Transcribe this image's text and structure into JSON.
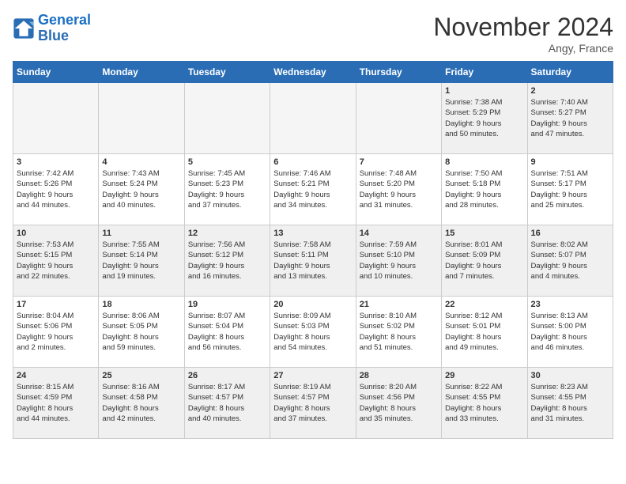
{
  "header": {
    "logo_line1": "General",
    "logo_line2": "Blue",
    "month": "November 2024",
    "location": "Angy, France"
  },
  "weekdays": [
    "Sunday",
    "Monday",
    "Tuesday",
    "Wednesday",
    "Thursday",
    "Friday",
    "Saturday"
  ],
  "weeks": [
    [
      {
        "day": "",
        "info": ""
      },
      {
        "day": "",
        "info": ""
      },
      {
        "day": "",
        "info": ""
      },
      {
        "day": "",
        "info": ""
      },
      {
        "day": "",
        "info": ""
      },
      {
        "day": "1",
        "info": "Sunrise: 7:38 AM\nSunset: 5:29 PM\nDaylight: 9 hours\nand 50 minutes."
      },
      {
        "day": "2",
        "info": "Sunrise: 7:40 AM\nSunset: 5:27 PM\nDaylight: 9 hours\nand 47 minutes."
      }
    ],
    [
      {
        "day": "3",
        "info": "Sunrise: 7:42 AM\nSunset: 5:26 PM\nDaylight: 9 hours\nand 44 minutes."
      },
      {
        "day": "4",
        "info": "Sunrise: 7:43 AM\nSunset: 5:24 PM\nDaylight: 9 hours\nand 40 minutes."
      },
      {
        "day": "5",
        "info": "Sunrise: 7:45 AM\nSunset: 5:23 PM\nDaylight: 9 hours\nand 37 minutes."
      },
      {
        "day": "6",
        "info": "Sunrise: 7:46 AM\nSunset: 5:21 PM\nDaylight: 9 hours\nand 34 minutes."
      },
      {
        "day": "7",
        "info": "Sunrise: 7:48 AM\nSunset: 5:20 PM\nDaylight: 9 hours\nand 31 minutes."
      },
      {
        "day": "8",
        "info": "Sunrise: 7:50 AM\nSunset: 5:18 PM\nDaylight: 9 hours\nand 28 minutes."
      },
      {
        "day": "9",
        "info": "Sunrise: 7:51 AM\nSunset: 5:17 PM\nDaylight: 9 hours\nand 25 minutes."
      }
    ],
    [
      {
        "day": "10",
        "info": "Sunrise: 7:53 AM\nSunset: 5:15 PM\nDaylight: 9 hours\nand 22 minutes."
      },
      {
        "day": "11",
        "info": "Sunrise: 7:55 AM\nSunset: 5:14 PM\nDaylight: 9 hours\nand 19 minutes."
      },
      {
        "day": "12",
        "info": "Sunrise: 7:56 AM\nSunset: 5:12 PM\nDaylight: 9 hours\nand 16 minutes."
      },
      {
        "day": "13",
        "info": "Sunrise: 7:58 AM\nSunset: 5:11 PM\nDaylight: 9 hours\nand 13 minutes."
      },
      {
        "day": "14",
        "info": "Sunrise: 7:59 AM\nSunset: 5:10 PM\nDaylight: 9 hours\nand 10 minutes."
      },
      {
        "day": "15",
        "info": "Sunrise: 8:01 AM\nSunset: 5:09 PM\nDaylight: 9 hours\nand 7 minutes."
      },
      {
        "day": "16",
        "info": "Sunrise: 8:02 AM\nSunset: 5:07 PM\nDaylight: 9 hours\nand 4 minutes."
      }
    ],
    [
      {
        "day": "17",
        "info": "Sunrise: 8:04 AM\nSunset: 5:06 PM\nDaylight: 9 hours\nand 2 minutes."
      },
      {
        "day": "18",
        "info": "Sunrise: 8:06 AM\nSunset: 5:05 PM\nDaylight: 8 hours\nand 59 minutes."
      },
      {
        "day": "19",
        "info": "Sunrise: 8:07 AM\nSunset: 5:04 PM\nDaylight: 8 hours\nand 56 minutes."
      },
      {
        "day": "20",
        "info": "Sunrise: 8:09 AM\nSunset: 5:03 PM\nDaylight: 8 hours\nand 54 minutes."
      },
      {
        "day": "21",
        "info": "Sunrise: 8:10 AM\nSunset: 5:02 PM\nDaylight: 8 hours\nand 51 minutes."
      },
      {
        "day": "22",
        "info": "Sunrise: 8:12 AM\nSunset: 5:01 PM\nDaylight: 8 hours\nand 49 minutes."
      },
      {
        "day": "23",
        "info": "Sunrise: 8:13 AM\nSunset: 5:00 PM\nDaylight: 8 hours\nand 46 minutes."
      }
    ],
    [
      {
        "day": "24",
        "info": "Sunrise: 8:15 AM\nSunset: 4:59 PM\nDaylight: 8 hours\nand 44 minutes."
      },
      {
        "day": "25",
        "info": "Sunrise: 8:16 AM\nSunset: 4:58 PM\nDaylight: 8 hours\nand 42 minutes."
      },
      {
        "day": "26",
        "info": "Sunrise: 8:17 AM\nSunset: 4:57 PM\nDaylight: 8 hours\nand 40 minutes."
      },
      {
        "day": "27",
        "info": "Sunrise: 8:19 AM\nSunset: 4:57 PM\nDaylight: 8 hours\nand 37 minutes."
      },
      {
        "day": "28",
        "info": "Sunrise: 8:20 AM\nSunset: 4:56 PM\nDaylight: 8 hours\nand 35 minutes."
      },
      {
        "day": "29",
        "info": "Sunrise: 8:22 AM\nSunset: 4:55 PM\nDaylight: 8 hours\nand 33 minutes."
      },
      {
        "day": "30",
        "info": "Sunrise: 8:23 AM\nSunset: 4:55 PM\nDaylight: 8 hours\nand 31 minutes."
      }
    ]
  ]
}
